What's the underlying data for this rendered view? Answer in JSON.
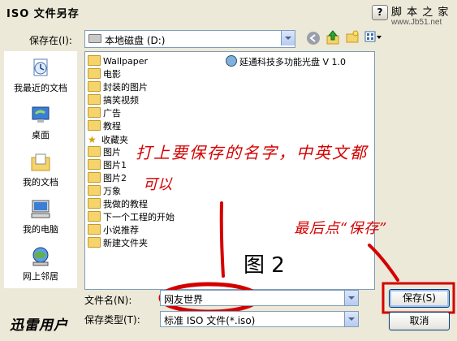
{
  "window": {
    "title": "ISO 文件另存",
    "help_label": "?"
  },
  "watermark": {
    "line1": "脚 本 之 家",
    "line2": "www.Jb51.net"
  },
  "save_in": {
    "label": "保存在(I):",
    "value": "本地磁盘 (D:)"
  },
  "places": [
    {
      "label": "我最近的文档",
      "icon": "recent-documents-icon"
    },
    {
      "label": "桌面",
      "icon": "desktop-icon"
    },
    {
      "label": "我的文档",
      "icon": "my-documents-icon"
    },
    {
      "label": "我的电脑",
      "icon": "my-computer-icon"
    },
    {
      "label": "网上邻居",
      "icon": "network-places-icon"
    }
  ],
  "files": {
    "col1": [
      "Wallpaper",
      "电影",
      "封装的图片",
      "搞笑视频",
      "广告",
      "教程",
      "收藏夹",
      "图片",
      "图片1",
      "图片2",
      "万象",
      "我做的教程",
      "下一个工程的开始",
      "小说推荐",
      "新建文件夹"
    ],
    "col2": [
      "延通科技多功能光盘 V 1.0"
    ]
  },
  "annotations": {
    "instruction": "打上要保存的名字，中英文都",
    "instruction2": "可以",
    "save_hint": "最后点“保存”",
    "figure": "图 2",
    "user_watermark": "迅雷用户"
  },
  "filename": {
    "label": "文件名(N):",
    "value": "网友世界"
  },
  "filetype": {
    "label": "保存类型(T):",
    "value": "标准 ISO 文件(*.iso)"
  },
  "buttons": {
    "save": "保存(S)",
    "cancel": "取消"
  },
  "colors": {
    "annotation_red": "#d40000",
    "list_border": "#7f9db9",
    "dialog_bg": "#ece9d8"
  }
}
